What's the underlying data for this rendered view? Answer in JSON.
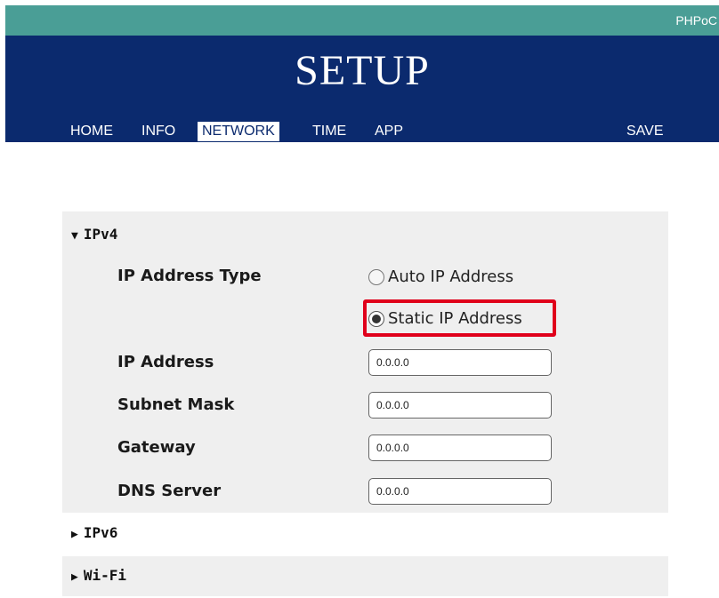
{
  "brand": "PHPoC",
  "title": "SETUP",
  "nav": {
    "home": "HOME",
    "info": "INFO",
    "network": "NETWORK",
    "time": "TIME",
    "app": "APP",
    "save": "SAVE"
  },
  "ipv4": {
    "heading": "IPv4",
    "ip_type_label": "IP Address Type",
    "auto_label": "Auto IP Address",
    "static_label": "Static IP Address",
    "selected_type": "Static IP Address",
    "ip_label": "IP Address",
    "ip_value": "0.0.0.0",
    "subnet_label": "Subnet Mask",
    "subnet_value": "0.0.0.0",
    "gateway_label": "Gateway",
    "gateway_value": "0.0.0.0",
    "dns_label": "DNS Server",
    "dns_value": "0.0.0.0"
  },
  "ipv6": {
    "heading": "IPv6"
  },
  "wifi": {
    "heading": "Wi-Fi"
  },
  "colors": {
    "topbar": "#4a9e96",
    "header": "#0b2a6e",
    "highlight": "#e0001b"
  },
  "icons": {
    "expanded": "triangle-down-icon",
    "collapsed": "triangle-right-icon"
  }
}
